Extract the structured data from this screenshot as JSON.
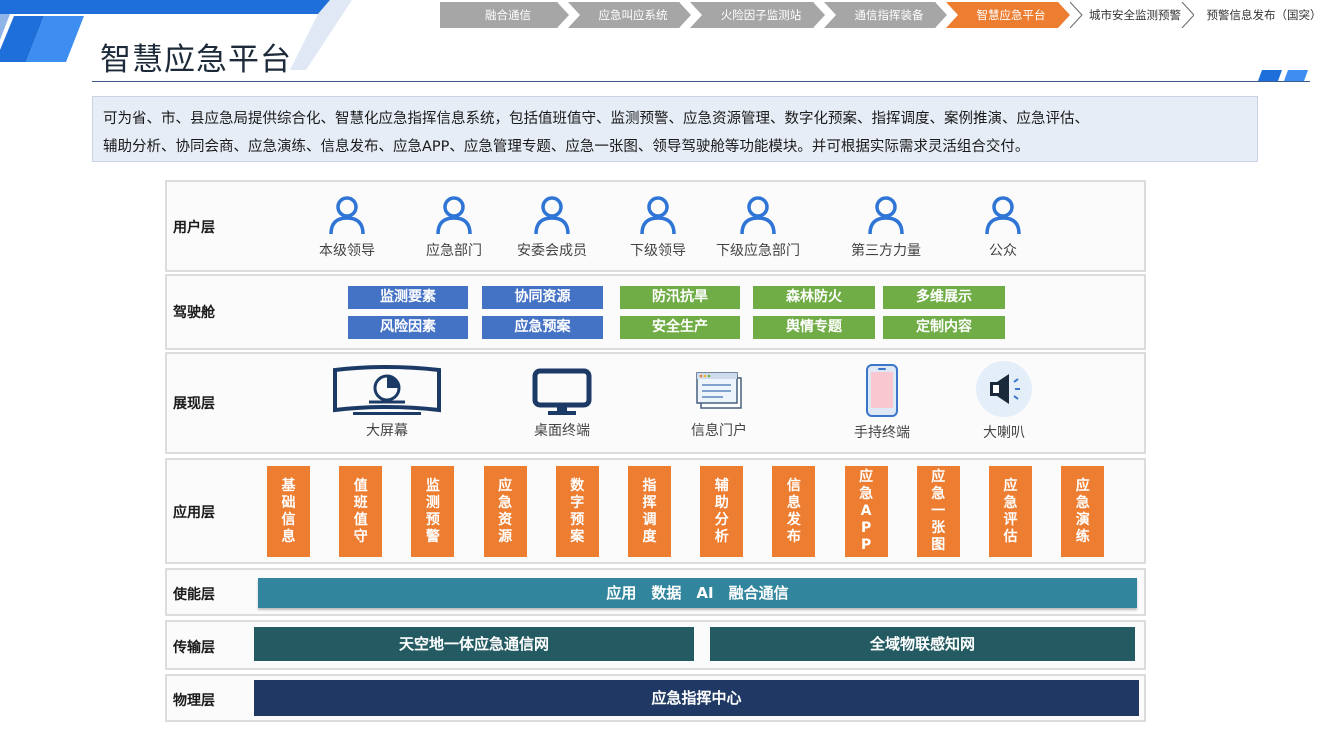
{
  "header": {
    "title": "智慧应急平台",
    "colors": {
      "accent": "#1e6fd9",
      "nav_gray": "#a6a6a6",
      "nav_active": "#ed7d31"
    }
  },
  "nav": {
    "items": [
      {
        "label": "融合通信",
        "state": "normal"
      },
      {
        "label": "应急叫应系统",
        "state": "normal"
      },
      {
        "label": "火险因子监测站",
        "state": "normal"
      },
      {
        "label": "通信指挥装备",
        "state": "normal"
      },
      {
        "label": "智慧应急平台",
        "state": "active"
      },
      {
        "label": "城市安全监测预警",
        "state": "plain"
      },
      {
        "label": "预警信息发布（国突）",
        "state": "plain"
      }
    ]
  },
  "description": {
    "line1": "可为省、市、县应急局提供综合化、智慧化应急指挥信息系统，包括值班值守、监测预警、应急资源管理、数字化预案、指挥调度、案例推演、应急评估、",
    "line2": "辅助分析、协同会商、应急演练、信息发布、应急APP、应急管理专题、应急一张图、领导驾驶舱等功能模块。并可根据实际需求灵活组合交付。"
  },
  "layers": {
    "user": {
      "label": "用户层",
      "icon": "person-icon",
      "items": [
        "本级领导",
        "应急部门",
        "安委会成员",
        "下级领导",
        "下级应急部门",
        "第三方力量",
        "公众"
      ]
    },
    "cockpit": {
      "label": "驾驶舱",
      "blue": [
        "监测要素",
        "协同资源",
        "风险因素",
        "应急预案"
      ],
      "green": [
        "防汛抗旱",
        "森林防火",
        "多维展示",
        "安全生产",
        "舆情专题",
        "定制内容"
      ]
    },
    "display": {
      "label": "展现层",
      "items": [
        {
          "label": "大屏幕",
          "icon": "big-screen-icon"
        },
        {
          "label": "桌面终端",
          "icon": "monitor-icon"
        },
        {
          "label": "信息门户",
          "icon": "portal-icon"
        },
        {
          "label": "手持终端",
          "icon": "phone-icon"
        },
        {
          "label": "大喇叭",
          "icon": "megaphone-icon"
        }
      ]
    },
    "application": {
      "label": "应用层",
      "items": [
        "基础信息",
        "值班值守",
        "监测预警",
        "应急资源",
        "数字预案",
        "指挥调度",
        "辅助分析",
        "信息发布",
        "应急APP",
        "应急一张图",
        "应急评估",
        "应急演练"
      ]
    },
    "enable": {
      "label": "使能层",
      "bar": "应用　数据　AI　融合通信"
    },
    "transport": {
      "label": "传输层",
      "left": "天空地一体应急通信网",
      "right": "全域物联感知网"
    },
    "physical": {
      "label": "物理层",
      "bar": "应急指挥中心"
    }
  }
}
